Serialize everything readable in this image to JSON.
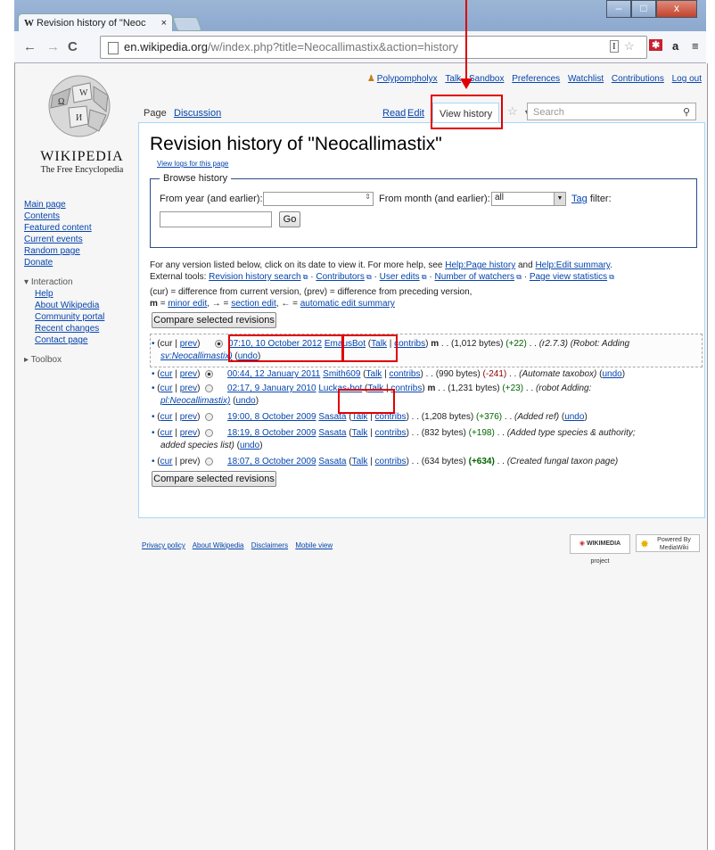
{
  "browser": {
    "tab_title": "Revision history of \"Neoc",
    "tab_close": "×",
    "url_host": "en.wikipedia.org",
    "url_path": "/w/index.php?title=Neocallimastix&action=history",
    "window_controls": [
      "–",
      "□",
      "x"
    ]
  },
  "wiki": {
    "logo_name": "WIKIPEDIA",
    "tagline": "The Free Encyclopedia",
    "nav_main": [
      "Main page",
      "Contents",
      "Featured content",
      "Current events",
      "Random page",
      "Donate"
    ],
    "interaction_header": "Interaction",
    "nav_interaction": [
      "Help",
      "About Wikipedia",
      "Community portal",
      "Recent changes",
      "Contact page"
    ],
    "toolbox_header": "Toolbox",
    "personal": [
      "Polypompholyx",
      "Talk",
      "Sandbox",
      "Preferences",
      "Watchlist",
      "Contributions",
      "Log out"
    ],
    "tab_page": "Page",
    "tab_discussion": "Discussion",
    "tab_read": "Read",
    "tab_edit": "Edit",
    "tab_view_history": "View history",
    "search_placeholder": "Search"
  },
  "content": {
    "title": "Revision history of \"Neocallimastix\"",
    "view_logs": "View logs for this page",
    "browse_legend": "Browse history",
    "from_year_label": "From year (and earlier):",
    "from_month_label": "From month (and earlier):",
    "month_value": "all",
    "tag_link": "Tag",
    "filter_label": "filter:",
    "go_button": "Go",
    "help_line_1a": "For any version listed below, click on its date to view it. For more help, see",
    "help_link_1": "Help:Page history",
    "help_and": "and",
    "help_link_2": "Help:Edit summary",
    "external_label": "External tools:",
    "external_tools": [
      "Revision history search",
      "Contributors",
      "User edits",
      "Number of watchers",
      "Page view statistics"
    ],
    "legend_line_1": "(cur) = difference from current version, (prev) = difference from preceding version,",
    "legend_m": "m",
    "legend_eq": "=",
    "legend_minor": "minor edit",
    "legend_arrow1": ", → =",
    "legend_section": "section edit",
    "legend_arrow2": ", ← =",
    "legend_auto": "automatic edit summary",
    "compare_button": "Compare selected revisions",
    "revisions": [
      {
        "cur": "cur",
        "prev": "prev",
        "date": "07:10, 10 October 2012",
        "user": "EmausBot",
        "talk": "Talk",
        "contribs": "contribs",
        "minor": "m",
        "size": "(1,012 bytes)",
        "diff": "(+22)",
        "summary": "(r2.7.3) (Robot: Adding",
        "summary2": "sv:Neocallimastix)",
        "undo": "undo"
      },
      {
        "cur": "cur",
        "prev": "prev",
        "date": "00:44, 12 January 2011",
        "user": "Smith609",
        "talk": "Talk",
        "contribs": "contribs",
        "minor": "",
        "size": "(990 bytes)",
        "diff": "(-241)",
        "summary": "(Automate taxobox)",
        "summary2": "",
        "undo": "undo"
      },
      {
        "cur": "cur",
        "prev": "prev",
        "date": "02:17, 9 January 2010",
        "user": "Luckas-bot",
        "talk": "Talk",
        "contribs": "contribs",
        "minor": "m",
        "size": "(1,231 bytes)",
        "diff": "(+23)",
        "summary": "(robot Adding:",
        "summary2": "pl:Neocallimastix)",
        "undo": "undo"
      },
      {
        "cur": "cur",
        "prev": "prev",
        "date": "19:00, 8 October 2009",
        "user": "Sasata",
        "talk": "Talk",
        "contribs": "contribs",
        "minor": "",
        "size": "(1,208 bytes)",
        "diff": "(+376)",
        "summary": "(Added ref)",
        "summary2": "",
        "undo": "undo"
      },
      {
        "cur": "cur",
        "prev": "prev",
        "date": "18:19, 8 October 2009",
        "user": "Sasata",
        "talk": "Talk",
        "contribs": "contribs",
        "minor": "",
        "size": "(832 bytes)",
        "diff": "(+198)",
        "summary": "(Added type species & authority;",
        "summary2": "added species list)",
        "undo": "undo"
      },
      {
        "cur": "cur",
        "prev": "prev",
        "date": "18:07, 8 October 2009",
        "user": "Sasata",
        "talk": "Talk",
        "contribs": "contribs",
        "minor": "",
        "size": "(634 bytes)",
        "diff": "(+634)",
        "summary": "(Created fungal taxon page)",
        "summary2": "",
        "undo": ""
      }
    ]
  },
  "footer": {
    "links": [
      "Privacy policy",
      "About Wikipedia",
      "Disclaimers",
      "Mobile view"
    ],
    "badge_wikimedia": "WIKIMEDIA",
    "badge_wikimedia_sub": "project",
    "badge_mediawiki_small": "Powered By",
    "badge_mediawiki": "MediaWiki"
  },
  "annotation_color": "#e00000"
}
